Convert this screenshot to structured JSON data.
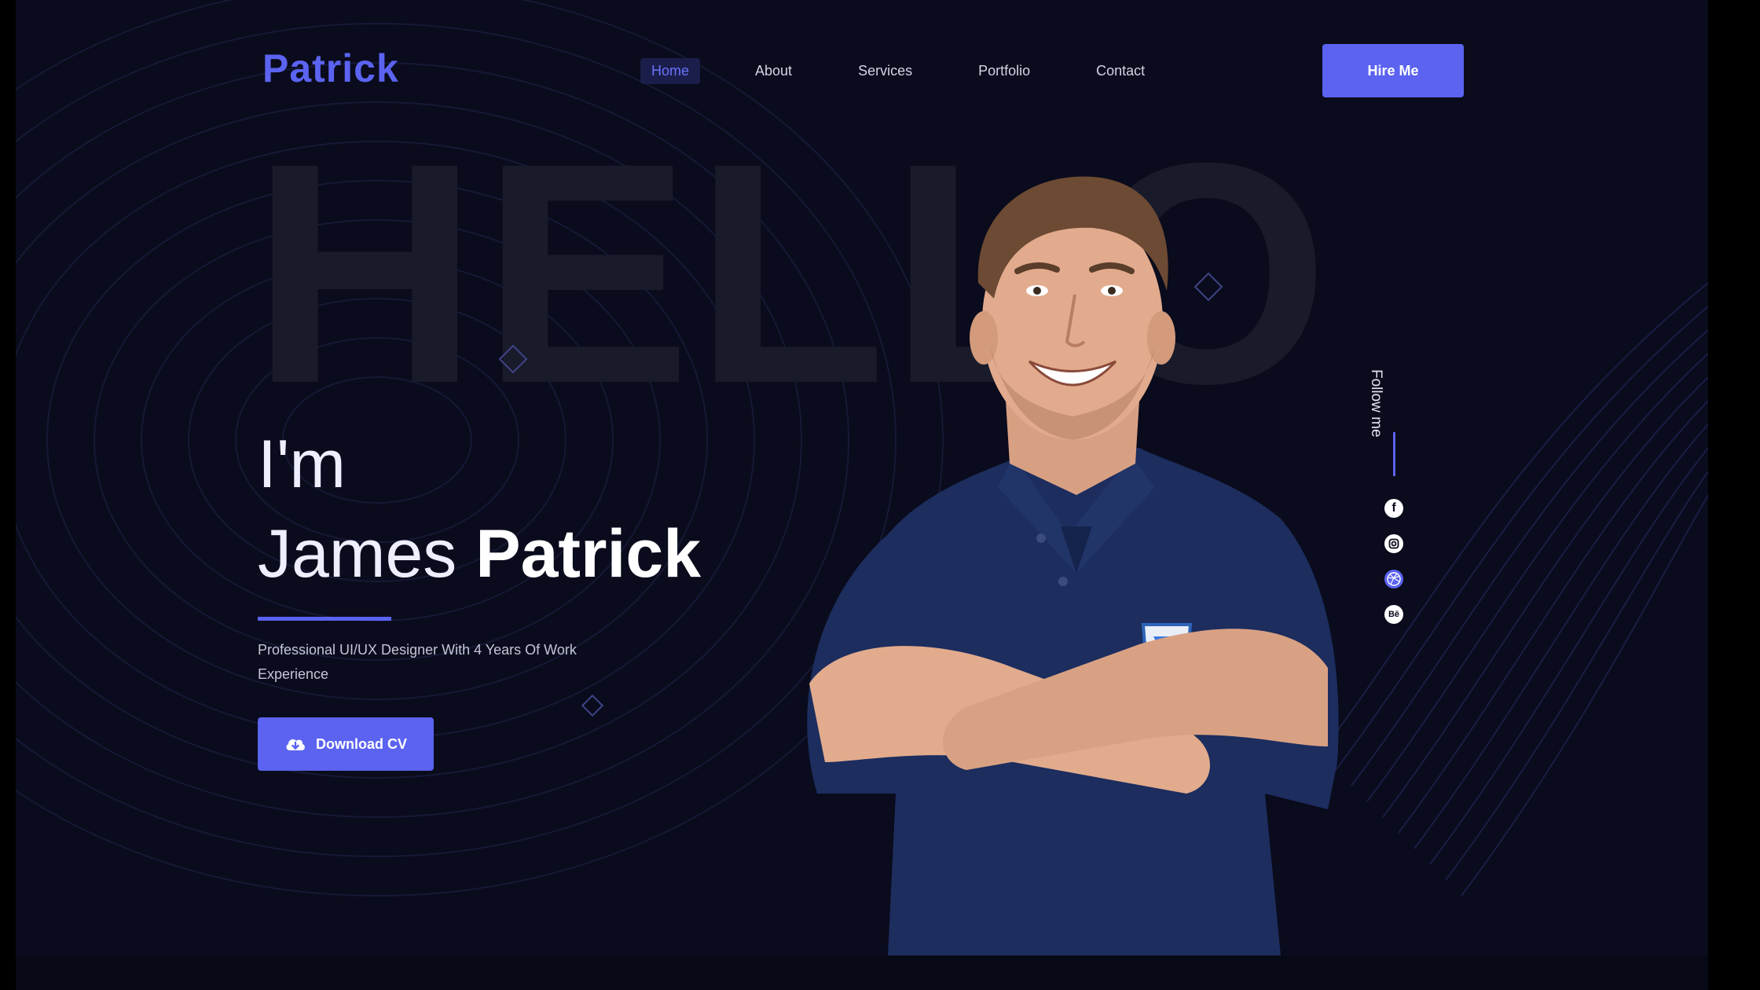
{
  "header": {
    "logo": "Patrick",
    "nav": [
      {
        "label": "Home",
        "active": true
      },
      {
        "label": "About",
        "active": false
      },
      {
        "label": "Services",
        "active": false
      },
      {
        "label": "Portfolio",
        "active": false
      },
      {
        "label": "Contact",
        "active": false
      }
    ],
    "hire_label": "Hire Me"
  },
  "hero": {
    "background_word": "HELLO",
    "greeting": "I'm",
    "first_name": "James",
    "last_name": "Patrick",
    "description": "Professional UI/UX Designer With 4 Years Of Work Experience",
    "download_label": "Download CV"
  },
  "social": {
    "follow_label": "Follow me",
    "icons": [
      "facebook-icon",
      "instagram-icon",
      "dribbble-icon",
      "behance-icon"
    ]
  },
  "colors": {
    "background": "#0a0b1c",
    "accent": "#5b63f0",
    "hello_text": "#1a1b2a",
    "shirt": "#1c2d5e"
  }
}
